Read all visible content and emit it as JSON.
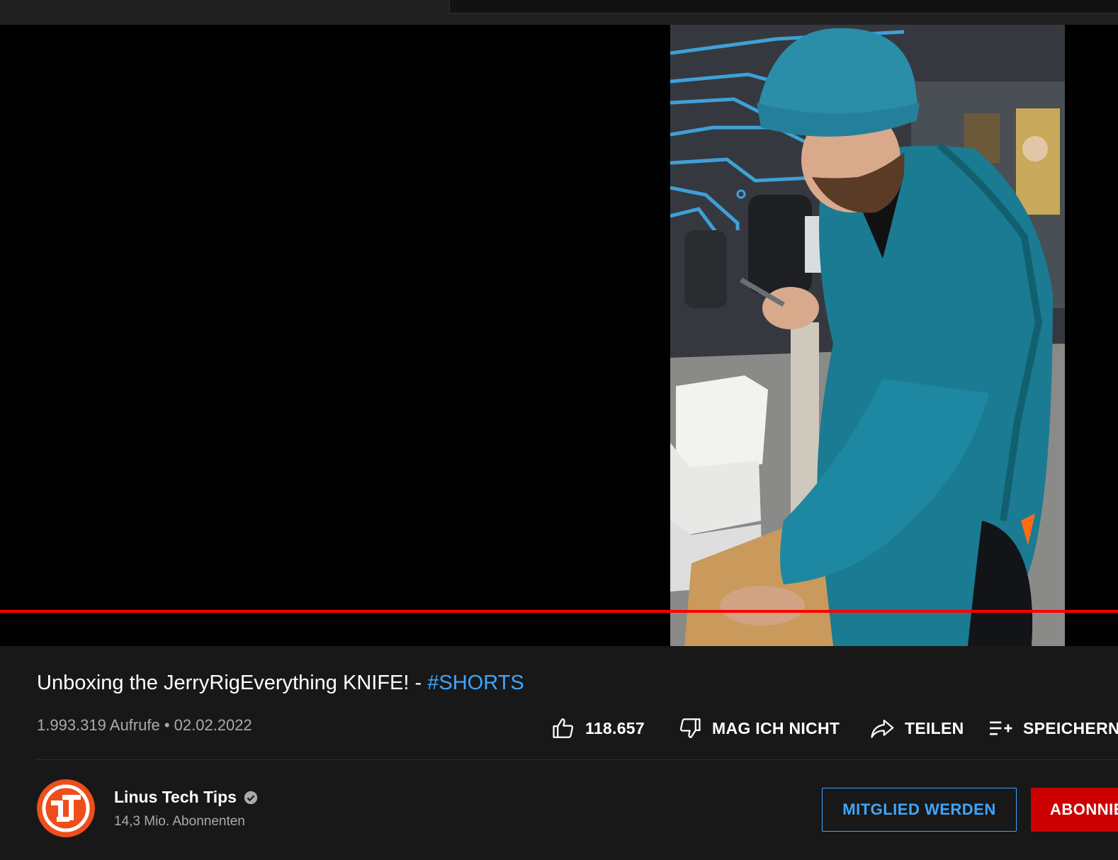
{
  "video": {
    "title_main": "Unboxing the JerryRigEverything KNIFE! - ",
    "title_hashtag": "#SHORTS",
    "views": "1.993.319 Aufrufe",
    "separator": " • ",
    "date": "02.02.2022",
    "progress_color": "#ff0000"
  },
  "actions": {
    "like_count": "118.657",
    "dislike_label": "MAG ICH NICHT",
    "share_label": "TEILEN",
    "save_label": "SPEICHERN"
  },
  "channel": {
    "name": "Linus Tech Tips",
    "subscribers": "14,3 Mio. Abonnenten",
    "verified_icon": "check-circle-icon",
    "avatar_color": "#ee4e1b"
  },
  "buttons": {
    "join": "MITGLIED WERDEN",
    "subscribe": "ABONNIEREN"
  },
  "colors": {
    "background": "#181818",
    "accent_blue": "#3ea6ff",
    "subscribe_red": "#cc0000"
  }
}
